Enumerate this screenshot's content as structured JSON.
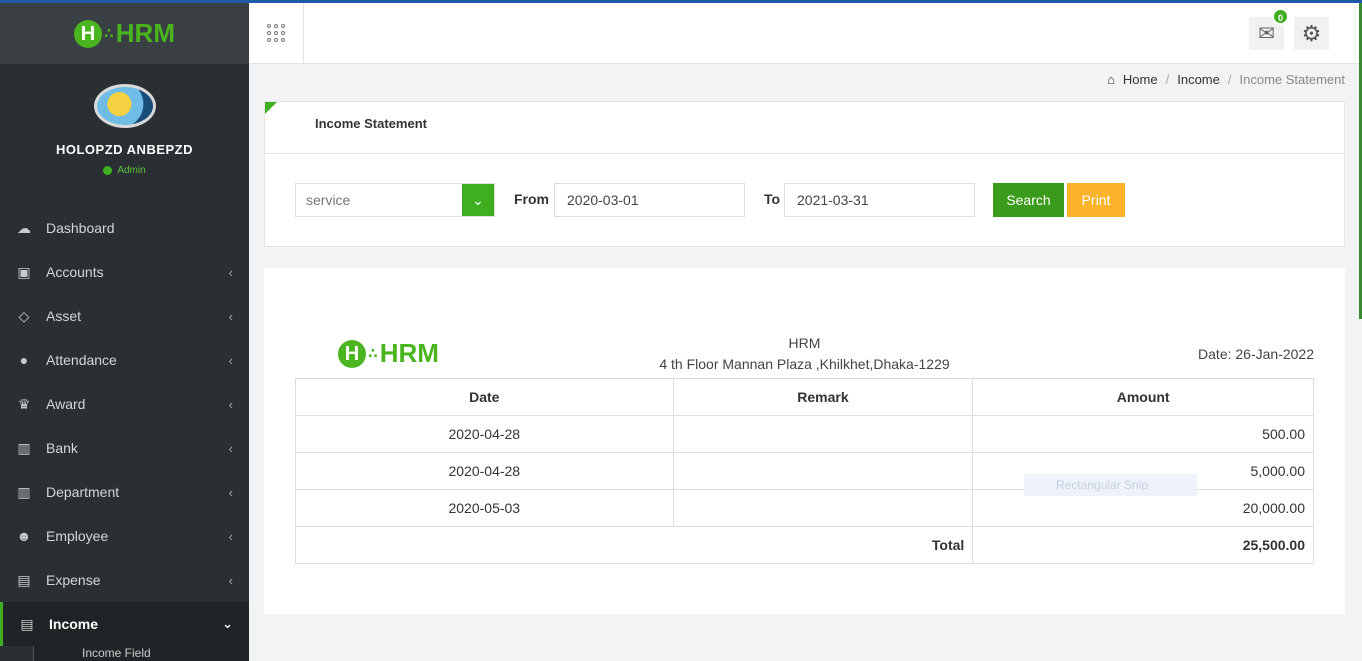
{
  "brand": {
    "logo_text": "HRM",
    "logo_h": "H"
  },
  "user": {
    "name": "HOLOPZD ANBEPZD",
    "role": "Admin"
  },
  "sidebar": {
    "items": [
      {
        "label": "Dashboard",
        "icon": "dashboard-icon",
        "glyph": "☁"
      },
      {
        "label": "Accounts",
        "icon": "briefcase-icon",
        "glyph": "▣"
      },
      {
        "label": "Asset",
        "icon": "diamond-icon",
        "glyph": "◇"
      },
      {
        "label": "Attendance",
        "icon": "user-icon",
        "glyph": "●"
      },
      {
        "label": "Award",
        "icon": "trophy-icon",
        "glyph": "♛"
      },
      {
        "label": "Bank",
        "icon": "bank-icon",
        "glyph": "▥"
      },
      {
        "label": "Department",
        "icon": "building-icon",
        "glyph": "▥"
      },
      {
        "label": "Employee",
        "icon": "users-icon",
        "glyph": "☻"
      },
      {
        "label": "Expense",
        "icon": "money-icon",
        "glyph": "▤"
      },
      {
        "label": "Income",
        "icon": "money-icon",
        "glyph": "▤"
      }
    ],
    "sub_item": "Income Field"
  },
  "header": {
    "notification_count": "0"
  },
  "breadcrumb": {
    "home": "Home",
    "section": "Income",
    "current": "Income Statement"
  },
  "filter": {
    "title": "Income Statement",
    "select_value": "service",
    "from_label": "From",
    "from_value": "2020-03-01",
    "to_label": "To",
    "to_value": "2021-03-31",
    "search_label": "Search",
    "print_label": "Print"
  },
  "report": {
    "company": "HRM",
    "address": "4 th Floor Mannan Plaza ,Khilkhet,Dhaka-1229",
    "date": "Date: 26-Jan-2022",
    "columns": [
      "Date",
      "Remark",
      "Amount"
    ],
    "rows": [
      {
        "date": "2020-04-28",
        "remark": "",
        "amount": "500.00"
      },
      {
        "date": "2020-04-28",
        "remark": "",
        "amount": "5,000.00"
      },
      {
        "date": "2020-05-03",
        "remark": "",
        "amount": "20,000.00"
      }
    ],
    "total_label": "Total",
    "total_value": "25,500.00"
  },
  "overlay": {
    "snip_label": "Rectangular Snip"
  },
  "colors": {
    "accent": "#3fae20",
    "print": "#fbb42a",
    "sidebar": "#2a2f33"
  }
}
